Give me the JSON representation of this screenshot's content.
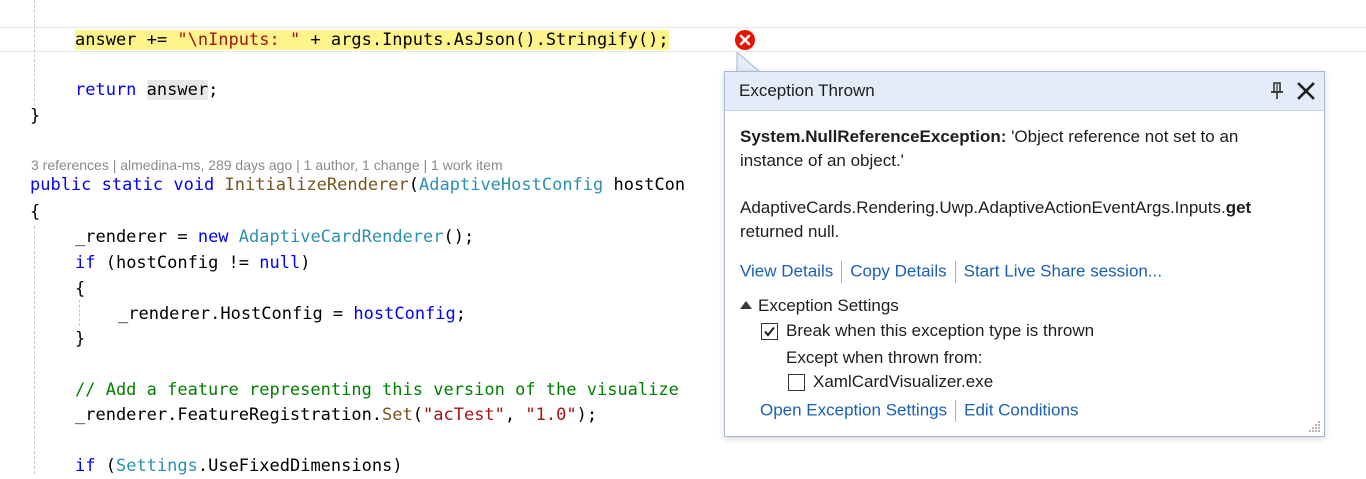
{
  "code": {
    "line_answer": {
      "plain_a": "answer += ",
      "string": "\"\\nInputs: \"",
      "plain_b": " + args.Inputs.AsJson().Stringify();"
    },
    "line_return": {
      "kw": "return",
      "space": " ",
      "ident": "answer",
      "semi": ";"
    },
    "line_close_brace": "}",
    "codelens": "3 references | almedina-ms, 289 days ago | 1 author, 1 change | 1 work item",
    "line_sig": {
      "kw1": "public",
      "kw2": "static",
      "kw3": "void",
      "method": "InitializeRenderer",
      "paren": "(",
      "type": "AdaptiveHostConfig",
      "param": " hostCon"
    },
    "line_open_brace": "{",
    "line_renderer_new": {
      "a": "_renderer = ",
      "kw": "new",
      "space": " ",
      "type": "AdaptiveCardRenderer",
      "b": "();"
    },
    "line_if_host": {
      "kw": "if",
      "a": " (hostConfig != ",
      "kw2": "null",
      "b": ")"
    },
    "line_brace_open2": "{",
    "line_assign": {
      "a": "_renderer.HostConfig = ",
      "b": "hostConfig",
      "c": ";"
    },
    "line_brace_close2": "}",
    "line_comment": "// Add a feature representing this version of the visualize",
    "line_feature": {
      "a": "_renderer.FeatureRegistration.",
      "meth": "Set",
      "b": "(",
      "s1": "\"acTest\"",
      "c": ", ",
      "s2": "\"1.0\"",
      "d": ");"
    },
    "line_if_settings": {
      "kw": "if",
      "a": " (",
      "type": "Settings",
      "b": ".UseFixedDimensions)"
    }
  },
  "popup": {
    "title": "Exception Thrown",
    "exception_type": "System.NullReferenceException:",
    "exception_message": " 'Object reference not set to an instance of an object.'",
    "source_main": "AdaptiveCards.Rendering.Uwp.AdaptiveActionEventArgs.Inputs.",
    "source_bold": "get",
    "source_tail": "returned null.",
    "links": [
      "View Details",
      "Copy Details",
      "Start Live Share session..."
    ],
    "settings_header": "Exception Settings",
    "break_label": "Break when this exception type is thrown",
    "break_checked": true,
    "except_label": "Except when thrown from:",
    "module_label": "XamlCardVisualizer.exe",
    "module_checked": false,
    "bottom_links": [
      "Open Exception Settings",
      "Edit Conditions"
    ]
  },
  "colors": {
    "keyword": "#0000ff",
    "type": "#2b91af",
    "string": "#a31515",
    "comment": "#008000",
    "highlight": "#fff48c",
    "error_red": "#e51400",
    "link": "#1a5fb4",
    "popup_header": "#e3ecf8"
  },
  "icons": [
    "error-icon",
    "pin-icon",
    "close-icon",
    "collapse-triangle-icon",
    "checkmark-icon",
    "resize-grip-icon"
  ]
}
